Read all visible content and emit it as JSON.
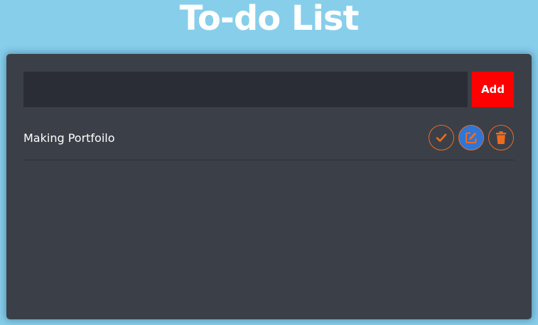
{
  "app": {
    "title": "To-do List"
  },
  "form": {
    "input_value": "",
    "input_placeholder": "",
    "add_label": "Add"
  },
  "tasks": [
    {
      "text": "Making Portfoilo",
      "actions": [
        "check-icon",
        "edit-icon",
        "trash-icon"
      ]
    }
  ],
  "colors": {
    "background": "#87ceeb",
    "panel": "#3b4048",
    "input": "#2a2d35",
    "add_button": "#ff0000",
    "accent_orange": "#f26a1b",
    "edit_blue": "#2f76d6"
  }
}
